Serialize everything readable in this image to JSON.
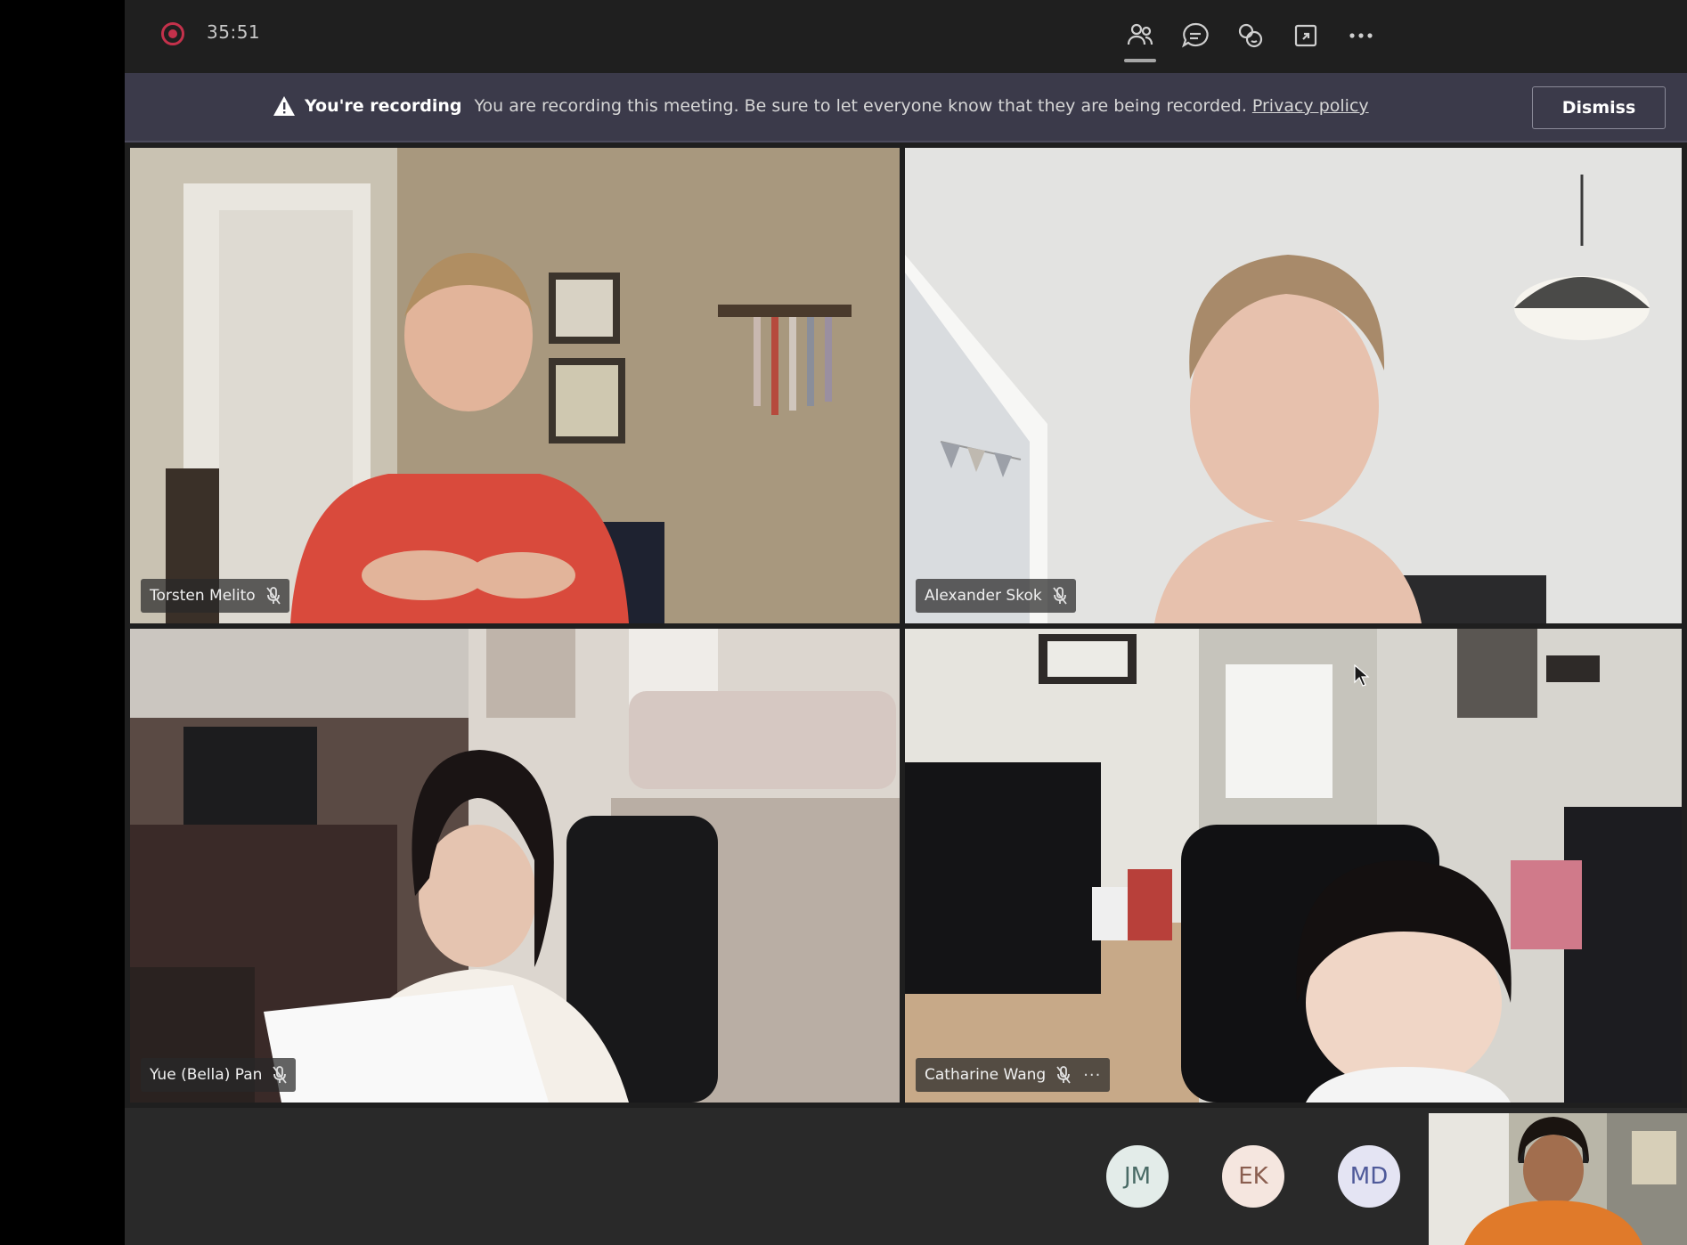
{
  "meeting": {
    "timer": "35:51"
  },
  "toolbar": {
    "icons": [
      "participants-icon",
      "chat-icon",
      "reactions-icon",
      "share-tray-icon",
      "more-options-icon"
    ]
  },
  "banner": {
    "title": "You're recording",
    "message": "You are recording this meeting. Be sure to let everyone know that they are being recorded.",
    "link": "Privacy policy",
    "dismiss": "Dismiss"
  },
  "participants": {
    "tiles": [
      {
        "name": "Torsten Melito",
        "mic": "mic-off-icon"
      },
      {
        "name": "Alexander Skok",
        "mic": "mic-off-icon"
      },
      {
        "name": "Yue (Bella) Pan",
        "mic": "mic-off-icon"
      },
      {
        "name": "Catharine Wang",
        "mic": "mic-off-icon",
        "more": "···"
      }
    ],
    "avatars": [
      {
        "initials": "JM",
        "bg": "#e3ece9",
        "fg": "#4a6b66"
      },
      {
        "initials": "EK",
        "bg": "#f5e6df",
        "fg": "#8a5e4f"
      },
      {
        "initials": "MD",
        "bg": "#e4e4f3",
        "fg": "#4f5a9a"
      }
    ]
  },
  "colors": {
    "record_red": "#c4314b",
    "banner_bg": "#3b3a4a",
    "app_bg": "#292929"
  }
}
